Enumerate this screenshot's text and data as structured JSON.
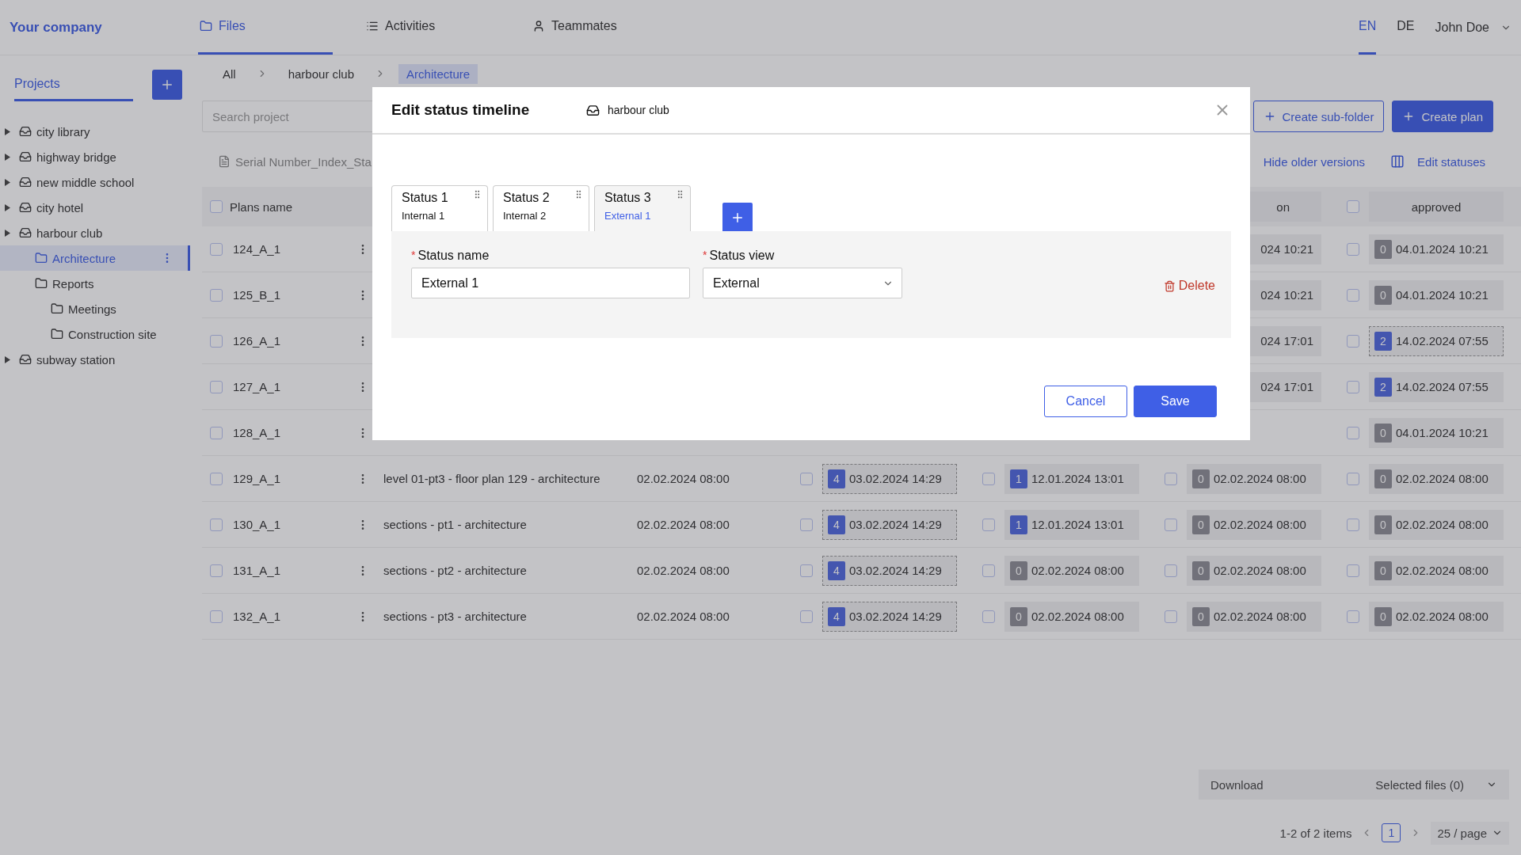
{
  "header": {
    "logo": "Your company",
    "nav": [
      {
        "label": "Files",
        "selected": true
      },
      {
        "label": "Activities",
        "selected": false
      },
      {
        "label": "Teammates",
        "selected": false
      }
    ],
    "languages": [
      {
        "label": "EN",
        "selected": true
      },
      {
        "label": "DE",
        "selected": false
      }
    ],
    "user": "John Doe"
  },
  "sidebar": {
    "tab": "Projects",
    "tree": [
      {
        "label": "city library",
        "kind": "project",
        "selected": false
      },
      {
        "label": "highway bridge",
        "kind": "project",
        "selected": false
      },
      {
        "label": "new middle school",
        "kind": "project",
        "selected": false
      },
      {
        "label": "city hotel",
        "kind": "project",
        "selected": false
      },
      {
        "label": "harbour club",
        "kind": "project",
        "selected": false,
        "children": [
          {
            "label": "Architecture",
            "kind": "folder",
            "selected": true
          },
          {
            "label": "Reports",
            "kind": "folder",
            "selected": false,
            "children": [
              {
                "label": "Meetings",
                "kind": "folder",
                "selected": false
              },
              {
                "label": "Construction site",
                "kind": "folder",
                "selected": false
              }
            ]
          }
        ]
      },
      {
        "label": "subway station",
        "kind": "project",
        "selected": false
      }
    ]
  },
  "breadcrumb": [
    {
      "label": "All",
      "selected": false
    },
    {
      "label": "harbour club",
      "selected": false
    },
    {
      "label": "Architecture",
      "selected": true
    }
  ],
  "search": {
    "placeholder": "Search project"
  },
  "actions": [
    {
      "label": "Create sub-folder",
      "kind": "outline"
    },
    {
      "label": "Create plan",
      "kind": "primary"
    }
  ],
  "file_name": "Serial Number_Index_Sta",
  "links": [
    {
      "label": "Hide older versions"
    },
    {
      "label": "Edit statuses"
    }
  ],
  "table": {
    "header": {
      "checked": false,
      "name": "Plans name",
      "status_3": "on",
      "status_4": "approved",
      "status_4_checked": false
    },
    "rows": [
      {
        "name": "124_A_1",
        "checked": false,
        "status_3": {
          "text": "024 10:21"
        },
        "status_4": {
          "checked": false,
          "count": "0",
          "active": false,
          "text": "04.01.2024 10:21",
          "highlighted": false
        }
      },
      {
        "name": "125_B_1",
        "checked": false,
        "status_3": {
          "text": "024 10:21"
        },
        "status_4": {
          "checked": false,
          "count": "0",
          "active": false,
          "text": "04.01.2024 10:21",
          "highlighted": false
        }
      },
      {
        "name": "126_A_1",
        "checked": false,
        "status_3": {
          "text": "024 17:01"
        },
        "status_4": {
          "checked": false,
          "count": "2",
          "active": true,
          "text": "14.02.2024 07:55",
          "highlighted": true
        }
      },
      {
        "name": "127_A_1",
        "checked": false,
        "status_3": {
          "text": "024 17:01"
        },
        "status_4": {
          "checked": false,
          "count": "2",
          "active": true,
          "text": "14.02.2024 07:55",
          "highlighted": false
        }
      },
      {
        "name": "128_A_1",
        "checked": false,
        "status_4": {
          "checked": false,
          "count": "0",
          "active": false,
          "text": "04.01.2024 10:21",
          "highlighted": false
        }
      },
      {
        "name": "129_A_1",
        "checked": false,
        "description": "level 01-pt3 - floor plan 129 - architecture",
        "date": "02.02.2024 08:00",
        "status_1": {
          "checked": false,
          "count": "4",
          "active": true,
          "text": "03.02.2024 14:29",
          "highlighted": true
        },
        "status_2": {
          "checked": false,
          "count": "1",
          "active": true,
          "text": "12.01.2024 13:01",
          "highlighted": false
        },
        "status_3": {
          "checked": false,
          "count": "0",
          "active": false,
          "text": "02.02.2024 08:00",
          "highlighted": false
        },
        "status_4": {
          "checked": false,
          "count": "0",
          "active": false,
          "text": "02.02.2024 08:00",
          "highlighted": false
        }
      },
      {
        "name": "130_A_1",
        "checked": false,
        "description": "sections - pt1 - architecture",
        "date": "02.02.2024 08:00",
        "status_1": {
          "checked": false,
          "count": "4",
          "active": true,
          "text": "03.02.2024 14:29",
          "highlighted": true
        },
        "status_2": {
          "checked": false,
          "count": "1",
          "active": true,
          "text": "12.01.2024 13:01",
          "highlighted": false
        },
        "status_3": {
          "checked": false,
          "count": "0",
          "active": false,
          "text": "02.02.2024 08:00",
          "highlighted": false
        },
        "status_4": {
          "checked": false,
          "count": "0",
          "active": false,
          "text": "02.02.2024 08:00",
          "highlighted": false
        }
      },
      {
        "name": "131_A_1",
        "checked": false,
        "description": "sections - pt2 - architecture",
        "date": "02.02.2024 08:00",
        "status_1": {
          "checked": false,
          "count": "4",
          "active": true,
          "text": "03.02.2024 14:29",
          "highlighted": true
        },
        "status_2": {
          "checked": false,
          "count": "0",
          "active": false,
          "text": "02.02.2024 08:00",
          "highlighted": false
        },
        "status_3": {
          "checked": false,
          "count": "0",
          "active": false,
          "text": "02.02.2024 08:00",
          "highlighted": false
        },
        "status_4": {
          "checked": false,
          "count": "0",
          "active": false,
          "text": "02.02.2024 08:00",
          "highlighted": false
        }
      },
      {
        "name": "132_A_1",
        "checked": false,
        "description": "sections - pt3 - architecture",
        "date": "02.02.2024 08:00",
        "status_1": {
          "checked": false,
          "count": "4",
          "active": true,
          "text": "03.02.2024 14:29",
          "highlighted": true
        },
        "status_2": {
          "checked": false,
          "count": "0",
          "active": false,
          "text": "02.02.2024 08:00",
          "highlighted": false
        },
        "status_3": {
          "checked": false,
          "count": "0",
          "active": false,
          "text": "02.02.2024 08:00",
          "highlighted": false
        },
        "status_4": {
          "checked": false,
          "count": "0",
          "active": false,
          "text": "02.02.2024 08:00",
          "highlighted": false
        }
      }
    ]
  },
  "download": {
    "label": "Download",
    "selection": "Selected files (0)"
  },
  "pagination": {
    "summary": "1-2 of 2 items",
    "pages": [
      {
        "label": "1",
        "selected": true
      }
    ],
    "page_size": "25 / page"
  },
  "modal": {
    "title": "Edit status timeline",
    "project": "harbour club",
    "statuses": [
      {
        "title": "Status 1",
        "subtitle": "Internal 1",
        "selected": false
      },
      {
        "title": "Status 2",
        "subtitle": "Internal 2",
        "selected": false
      },
      {
        "title": "Status 3",
        "subtitle": "External 1",
        "selected": true
      }
    ],
    "fields": [
      {
        "kind": "input",
        "mark": "*",
        "label": "Status name",
        "value": "External 1"
      },
      {
        "kind": "select",
        "mark": "*",
        "label": "Status view",
        "value": "External"
      }
    ],
    "delete": "Delete",
    "buttons": [
      {
        "label": "Cancel",
        "kind": "secondary"
      },
      {
        "label": "Save",
        "kind": "primary"
      }
    ]
  }
}
